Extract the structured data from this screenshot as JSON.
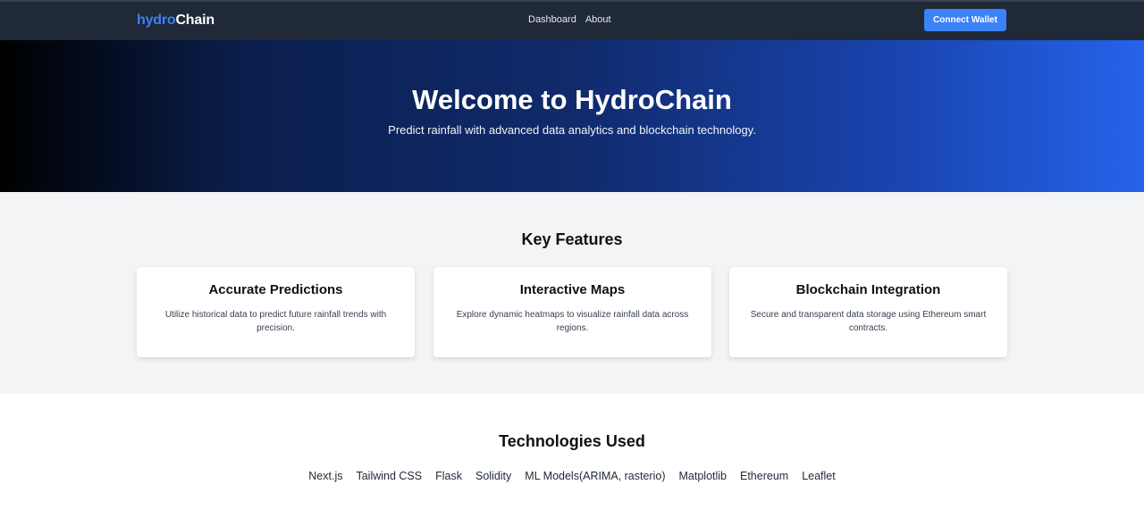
{
  "navbar": {
    "brand_part1": "hydro",
    "brand_part2": "Chain",
    "links": [
      "Dashboard",
      "About"
    ],
    "connect_label": "Connect Wallet",
    "accent_color": "#3b82f6",
    "background_color": "#1f2937"
  },
  "hero": {
    "title": "Welcome to HydroChain",
    "subtitle": "Predict rainfall with advanced data analytics and blockchain technology."
  },
  "features": {
    "title": "Key Features",
    "cards": [
      {
        "title": "Accurate Predictions",
        "description": "Utilize historical data to predict future rainfall trends with precision."
      },
      {
        "title": "Interactive Maps",
        "description": "Explore dynamic heatmaps to visualize rainfall data across regions."
      },
      {
        "title": "Blockchain Integration",
        "description": "Secure and transparent data storage using Ethereum smart contracts."
      }
    ]
  },
  "technologies": {
    "title": "Technologies Used",
    "items": [
      "Next.js",
      "Tailwind CSS",
      "Flask",
      "Solidity",
      "ML Models(ARIMA, rasterio)",
      "Matplotlib",
      "Ethereum",
      "Leaflet"
    ]
  }
}
